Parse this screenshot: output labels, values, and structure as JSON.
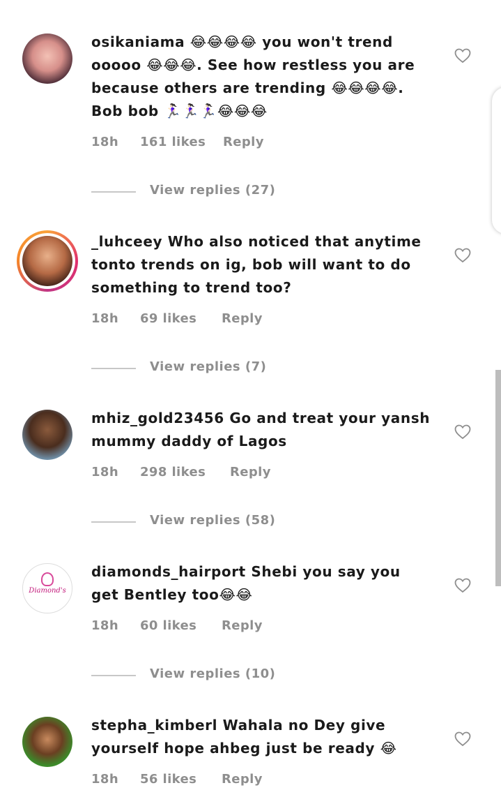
{
  "comments": [
    {
      "username": "osikaniama",
      "text": " 😂😂😂😂 you won't trend ooooo 😂😂😂. See how restless you are because others are trending 😂😂😂😂. Bob bob 🏃🏻‍♀️🏃🏻‍♀️🏃🏻‍♀️😂😂😂",
      "time": "18h",
      "likes": "161 likes",
      "reply": "Reply",
      "view_replies": "View replies (27)"
    },
    {
      "username": "_luhceey",
      "text": " Who also noticed that anytime tonto trends on ig, bob will want to do something to trend too?",
      "time": "18h",
      "likes": "69 likes",
      "reply": "Reply",
      "view_replies": "View replies (7)"
    },
    {
      "username": "mhiz_gold23456",
      "text": " Go and treat your yansh mummy daddy of Lagos",
      "time": "18h",
      "likes": "298 likes",
      "reply": "Reply",
      "view_replies": "View replies (58)"
    },
    {
      "username": "diamonds_hairport",
      "text": " Shebi you say you get Bentley too😂😂",
      "time": "18h",
      "likes": "60 likes",
      "reply": "Reply",
      "view_replies": "View replies (10)",
      "avatar_text": "Diamond's"
    },
    {
      "username": "stepha_kimberl",
      "text": " Wahala no Dey give yourself hope ahbeg just be ready 😂",
      "time": "18h",
      "likes": "56 likes",
      "reply": "Reply"
    }
  ],
  "colors": {
    "meta_text": "#8e8e8e",
    "story_ring": [
      "#f9a23a",
      "#e1306c",
      "#c13584"
    ]
  }
}
